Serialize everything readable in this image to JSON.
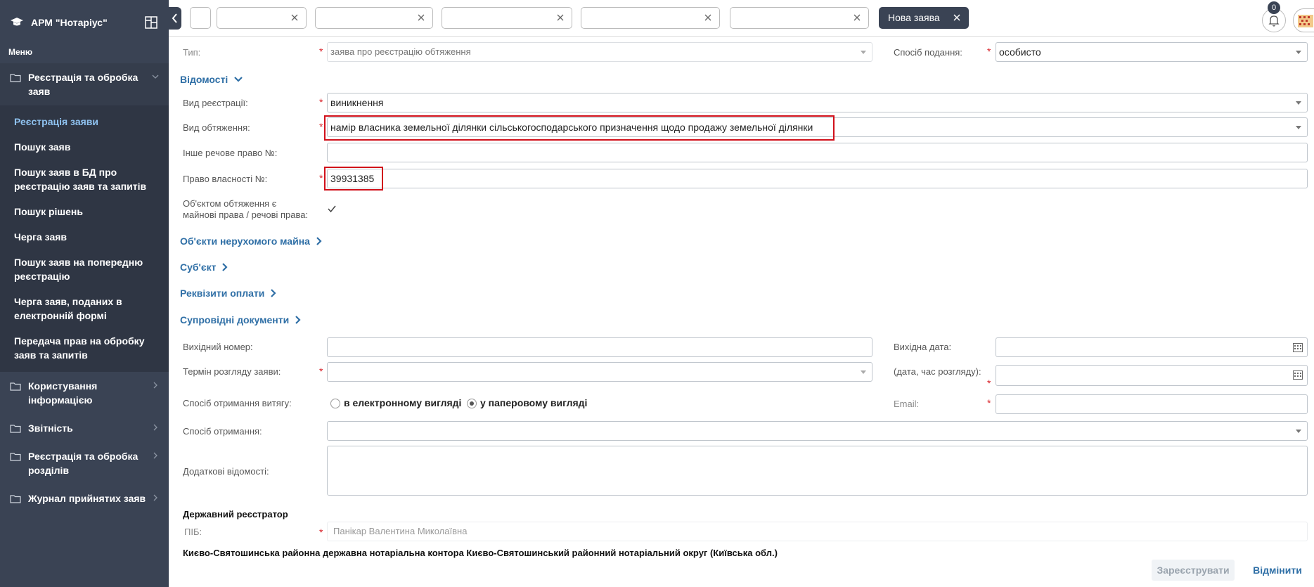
{
  "sidebar": {
    "app_title": "АРМ \"Нотаріус\"",
    "menu_label": "Меню",
    "group_open": "Реєстрація та обробка заяв",
    "items": [
      {
        "label": "Реєстрація заяви"
      },
      {
        "label": "Пошук заяв"
      },
      {
        "label": "Пошук заяв в БД про реєстрацію заяв та запитів"
      },
      {
        "label": "Пошук рішень"
      },
      {
        "label": "Черга заяв"
      },
      {
        "label": "Пошук заяв на попередню реєстрацію"
      },
      {
        "label": "Черга заяв, поданих в електронній формі"
      },
      {
        "label": "Передача прав на обробку заяв та запитів"
      }
    ],
    "groups": [
      {
        "label": "Користування інформацією"
      },
      {
        "label": "Звітність"
      },
      {
        "label": "Реєстрація та обробка розділів"
      },
      {
        "label": "Журнал прийнятих заяв"
      }
    ]
  },
  "topbar": {
    "active_tab": "Нова заява",
    "notification_count": "0"
  },
  "form": {
    "type_label": "Тип:",
    "type_value": "заява про реєстрацію обтяження",
    "submit_method_label": "Спосіб подання:",
    "submit_method_value": "особисто",
    "section_info": "Відомості",
    "reg_kind_label": "Вид реєстрації:",
    "reg_kind_value": "виникнення",
    "encumbrance_label": "Вид обтяження:",
    "encumbrance_value": "намір власника земельної ділянки сільськогосподарського призначення щодо продажу земельної ділянки",
    "other_right_label": "Інше речове право №:",
    "other_right_value": "",
    "ownership_label": "Право власності №:",
    "ownership_value": "39931385",
    "object_label_1": "Об'єктом обтяження є",
    "object_label_2": "майнові права / речові права:",
    "section_objects": "Об'єкти нерухомого майна",
    "section_subject": "Суб'єкт",
    "section_payment": "Реквізити оплати",
    "section_docs": "Супровідні документи",
    "out_number_label": "Вихідний номер:",
    "out_date_label": "Вихідна дата:",
    "review_term_label": "Термін розгляду заяви:",
    "review_date_label": "(дата, час розгляду):",
    "extract_method_label": "Спосіб отримання витягу:",
    "radio_electronic": "в електронному вигляді",
    "radio_paper": "у паперовому вигляді",
    "email_label": "Email:",
    "receive_method_label": "Спосіб отримання:",
    "additional_label": "Додаткові відомості:",
    "registrar_heading": "Державний реєстратор",
    "pib_label": "ПІБ:",
    "pib_value": "Панікар Валентина Миколаївна",
    "office_text": "Києво-Святошинська районна державна нотаріальна контора Києво-Святошинський районний нотаріальний округ (Київська обл.)",
    "register_button": "Зареєструвати",
    "cancel_button": "Відмінити"
  }
}
